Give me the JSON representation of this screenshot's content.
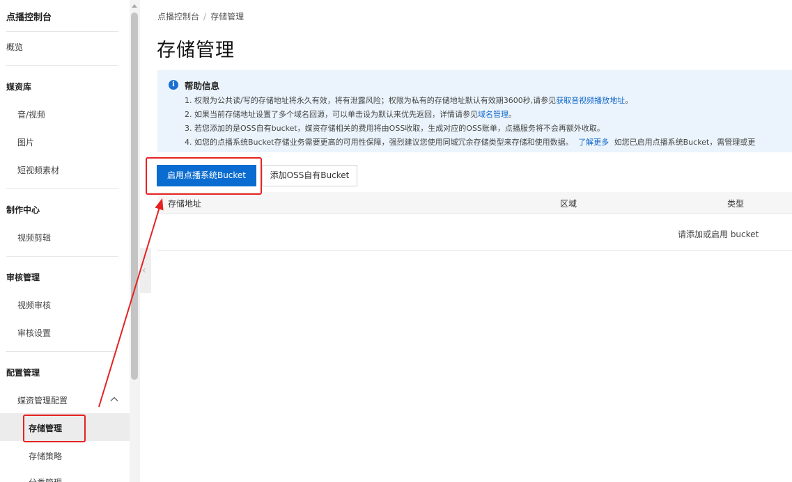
{
  "sidebar": {
    "title": "点播控制台",
    "overview": "概览",
    "groups": [
      {
        "label": "媒资库",
        "items": [
          "音/视频",
          "图片",
          "短视频素材"
        ]
      },
      {
        "label": "制作中心",
        "items": [
          "视频剪辑"
        ]
      },
      {
        "label": "审核管理",
        "items": [
          "视频审核",
          "审核设置"
        ]
      },
      {
        "label": "配置管理",
        "items": [
          "媒资管理配置"
        ]
      }
    ],
    "sub_items": {
      "active": "存储管理",
      "next": "存储策略",
      "partial": "分类管理"
    }
  },
  "breadcrumb": {
    "root": "点播控制台",
    "separator": "/",
    "current": "存储管理"
  },
  "page": {
    "title": "存储管理"
  },
  "help": {
    "icon": "info-icon",
    "title": "帮助信息",
    "line1_text": "1. 权限为公共读/写的存储地址将永久有效，将有泄露风险；权限为私有的存储地址默认有效期3600秒,请参见",
    "line1_link": "获取音视频播放地址",
    "line1_end": "。",
    "line2_text": "2. 如果当前存储地址设置了多个域名回源，可以单击设为默认来优先返回，详情请参见",
    "line2_link": "域名管理",
    "line2_end": "。",
    "line3_text": "3. 若您添加的是OSS自有bucket，媒资存储相关的费用将由OSS收取，生成对应的OSS账单，点播服务将不会再额外收取。",
    "line4_text": "4. 如您的点播系统Bucket存储业务需要更高的可用性保障，强烈建议您使用同城冗余存储类型来存储和使用数据。",
    "line4_link": "了解更多",
    "line4_end": "如您已启用点播系统Bucket，需管理或更"
  },
  "actions": {
    "enable_bucket": "启用点播系统Bucket",
    "add_oss_bucket": "添加OSS自有Bucket"
  },
  "table": {
    "columns": [
      "存储地址",
      "区域",
      "类型"
    ],
    "empty_text": "请添加或启用 bucket"
  },
  "colors": {
    "primary": "#0a6cd0",
    "link": "#0d64c8",
    "help_bg": "#ebf4fc",
    "highlight": "#e52222"
  }
}
